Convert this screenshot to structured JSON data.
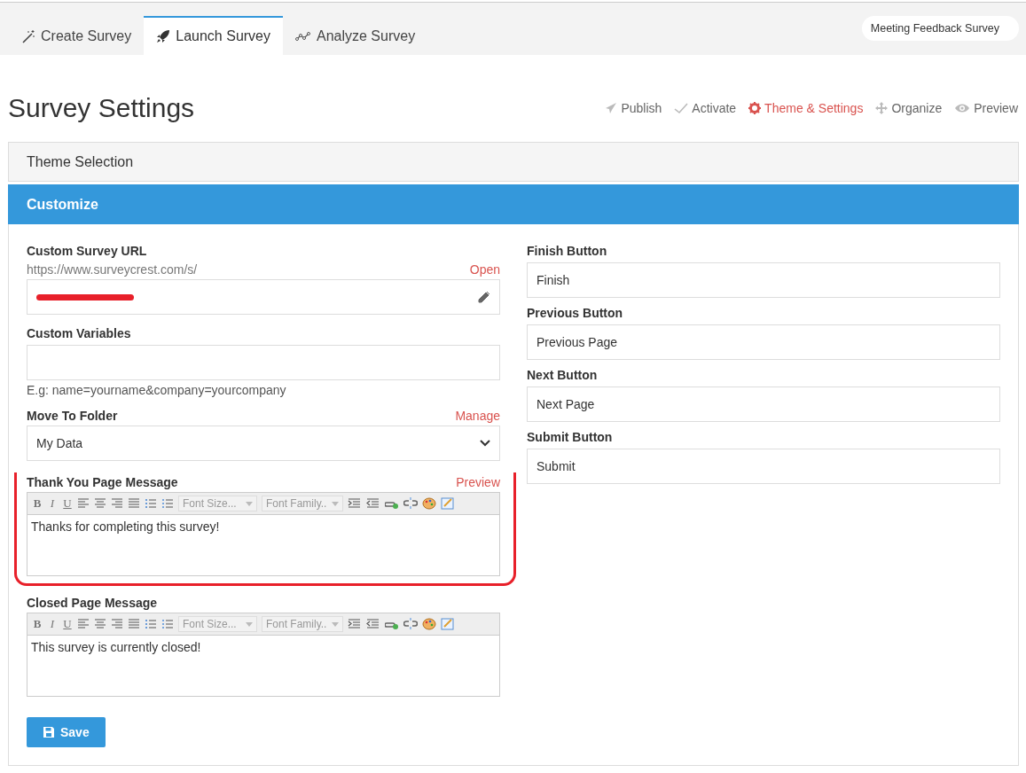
{
  "tabs": [
    {
      "label": "Create Survey",
      "selected": false
    },
    {
      "label": "Launch Survey",
      "selected": true
    },
    {
      "label": "Analyze Survey",
      "selected": false
    }
  ],
  "survey_name": "Meeting Feedback Survey",
  "page_title": "Survey Settings",
  "actions": [
    {
      "label": "Publish",
      "selected": false
    },
    {
      "label": "Activate",
      "selected": false
    },
    {
      "label": "Theme & Settings",
      "selected": true
    },
    {
      "label": "Organize",
      "selected": false
    },
    {
      "label": "Preview",
      "selected": false
    }
  ],
  "panels": [
    {
      "title": "Theme Selection",
      "selected": false
    },
    {
      "title": "Customize",
      "selected": true
    }
  ],
  "custom_url": {
    "label": "Custom Survey URL",
    "prefix": "https://www.surveycrest.com/s/",
    "link": "Open"
  },
  "custom_variables": {
    "label": "Custom Variables",
    "hint": "E.g: name=yourname&company=yourcompany"
  },
  "folder": {
    "label": "Move To Folder",
    "link": "Manage",
    "value": "My Data"
  },
  "editors": [
    {
      "label": "Thank You Page Message",
      "link": "Preview",
      "highlighted": true,
      "format_buttons": [
        "B",
        "I",
        "U"
      ],
      "font_size": "Font Size...",
      "font_family": "Font Family..",
      "content": "Thanks for completing this survey!"
    },
    {
      "label": "Closed Page Message",
      "highlighted": false,
      "format_buttons": [
        "B",
        "I",
        "U"
      ],
      "font_size": "Font Size...",
      "font_family": "Font Family..",
      "content": "This survey is currently closed!"
    }
  ],
  "button_fields": [
    {
      "label": "Finish Button",
      "value": "Finish"
    },
    {
      "label": "Previous Button",
      "value": "Previous Page"
    },
    {
      "label": "Next Button",
      "value": "Next Page"
    },
    {
      "label": "Submit Button",
      "value": "Submit"
    }
  ],
  "save_button": "Save"
}
